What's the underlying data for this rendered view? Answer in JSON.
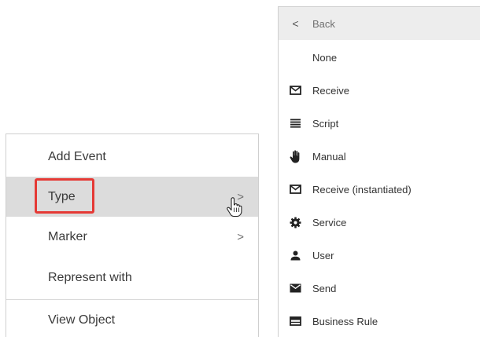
{
  "left_menu": {
    "items": [
      {
        "label": "Add Event",
        "has_submenu": false
      },
      {
        "label": "Type",
        "has_submenu": true,
        "hovered": true
      },
      {
        "label": "Marker",
        "has_submenu": true
      },
      {
        "label": "Represent with",
        "has_submenu": false
      },
      {
        "label": "View Object",
        "has_submenu": false
      }
    ],
    "chevron": ">",
    "highlight_color": "#e53935"
  },
  "right_menu": {
    "back_label": "Back",
    "back_icon": "<",
    "items": [
      {
        "label": "None",
        "icon": "none"
      },
      {
        "label": "Receive",
        "icon": "envelope-outline-icon"
      },
      {
        "label": "Script",
        "icon": "script-lines-icon"
      },
      {
        "label": "Manual",
        "icon": "hand-icon"
      },
      {
        "label": "Receive (instantiated)",
        "icon": "envelope-outline-icon"
      },
      {
        "label": "Service",
        "icon": "gear-icon"
      },
      {
        "label": "User",
        "icon": "user-icon"
      },
      {
        "label": "Send",
        "icon": "envelope-filled-icon"
      },
      {
        "label": "Business Rule",
        "icon": "business-rule-table-icon"
      }
    ]
  }
}
